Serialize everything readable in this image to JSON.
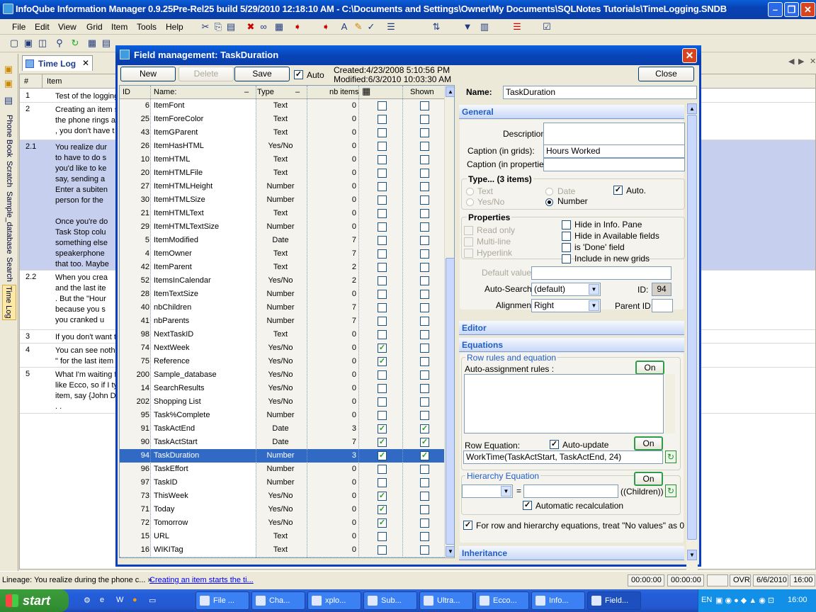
{
  "window": {
    "title": "InfoQube Information Manager 0.9.25Pre-Rel25  build 5/29/2010 12:18:10 AM - C:\\Documents and Settings\\Owner\\My Documents\\SQLNotes Tutorials\\TimeLogging.SNDB"
  },
  "menu": [
    "File",
    "Edit",
    "View",
    "Grid",
    "Item",
    "Tools",
    "Help"
  ],
  "left_tabs": [
    "Phone Book",
    "Scratch",
    "Sample_database",
    "Search",
    "Time Log"
  ],
  "doc_tab": {
    "label": "Time Log",
    "close": "✕"
  },
  "bg_grid": {
    "headers": {
      "num": "#",
      "item": "Item"
    },
    "rows": [
      {
        "num": "1",
        "lines": [
          "Test of the logging"
        ]
      },
      {
        "num": "2",
        "lines": [
          "Creating an item s",
          "the phone rings a",
          ", you don't have t"
        ]
      },
      {
        "num": "2.1",
        "lines": [
          "You realize dur",
          "to have to do s",
          "you'd like to ke",
          "say, sending a",
          "Enter a subiten",
          "person for the",
          "",
          "Once you're do",
          "Task Stop colu",
          "something else",
          "speakerphone",
          "that too. Maybe"
        ]
      },
      {
        "num": "2.2",
        "lines": [
          "When you crea",
          "and the last ite",
          ". But the \"Hour",
          "because you s",
          "you cranked u"
        ]
      },
      {
        "num": "3",
        "lines": [
          "If you don't want t"
        ]
      },
      {
        "num": "4",
        "lines": [
          "You can see noth",
          "\" for the last item"
        ]
      },
      {
        "num": "5",
        "lines": [
          "What I'm waiting f",
          "like Ecco, so if I ty",
          "item, say {John D",
          ". ."
        ]
      }
    ]
  },
  "dialog": {
    "title": "Field management: TaskDuration",
    "close": "✕",
    "buttons": {
      "new": "New",
      "delete": "Delete",
      "save": "Save",
      "close": "Close"
    },
    "auto_label": "Auto",
    "created": "Created:4/23/2008 5:10:56 PM",
    "modified": "Modified:6/3/2010 10:03:30 AM",
    "grid": {
      "headers": {
        "id": "ID",
        "name": "Name:",
        "type": "Type",
        "nb": "nb items",
        "shown": "Shown"
      },
      "rows": [
        {
          "id": "6",
          "name": "ItemFont",
          "type": "Text",
          "nb": "0",
          "a": false,
          "s": false
        },
        {
          "id": "25",
          "name": "ItemForeColor",
          "type": "Text",
          "nb": "0",
          "a": false,
          "s": false
        },
        {
          "id": "43",
          "name": "ItemGParent",
          "type": "Text",
          "nb": "0",
          "a": false,
          "s": false
        },
        {
          "id": "26",
          "name": "ItemHasHTML",
          "type": "Yes/No",
          "nb": "0",
          "a": false,
          "s": false
        },
        {
          "id": "10",
          "name": "ItemHTML",
          "type": "Text",
          "nb": "0",
          "a": false,
          "s": false
        },
        {
          "id": "20",
          "name": "ItemHTMLFile",
          "type": "Text",
          "nb": "0",
          "a": false,
          "s": false
        },
        {
          "id": "27",
          "name": "ItemHTMLHeight",
          "type": "Number",
          "nb": "0",
          "a": false,
          "s": false
        },
        {
          "id": "30",
          "name": "ItemHTMLSize",
          "type": "Number",
          "nb": "0",
          "a": false,
          "s": false
        },
        {
          "id": "21",
          "name": "ItemHTMLText",
          "type": "Text",
          "nb": "0",
          "a": false,
          "s": false
        },
        {
          "id": "29",
          "name": "ItemHTMLTextSize",
          "type": "Number",
          "nb": "0",
          "a": false,
          "s": false
        },
        {
          "id": "5",
          "name": "ItemModified",
          "type": "Date",
          "nb": "7",
          "a": false,
          "s": false
        },
        {
          "id": "4",
          "name": "ItemOwner",
          "type": "Text",
          "nb": "7",
          "a": false,
          "s": false
        },
        {
          "id": "42",
          "name": "ItemParent",
          "type": "Text",
          "nb": "2",
          "a": false,
          "s": false
        },
        {
          "id": "52",
          "name": "ItemsInCalendar",
          "type": "Yes/No",
          "nb": "2",
          "a": false,
          "s": false
        },
        {
          "id": "28",
          "name": "ItemTextSize",
          "type": "Number",
          "nb": "0",
          "a": false,
          "s": false
        },
        {
          "id": "40",
          "name": "nbChildren",
          "type": "Number",
          "nb": "7",
          "a": false,
          "s": false
        },
        {
          "id": "41",
          "name": "nbParents",
          "type": "Number",
          "nb": "7",
          "a": false,
          "s": false
        },
        {
          "id": "98",
          "name": "NextTaskID",
          "type": "Text",
          "nb": "0",
          "a": false,
          "s": false
        },
        {
          "id": "74",
          "name": "NextWeek",
          "type": "Yes/No",
          "nb": "0",
          "a": true,
          "s": false
        },
        {
          "id": "75",
          "name": "Reference",
          "type": "Yes/No",
          "nb": "0",
          "a": true,
          "s": false
        },
        {
          "id": "200",
          "name": "Sample_database",
          "type": "Yes/No",
          "nb": "0",
          "a": false,
          "s": false
        },
        {
          "id": "14",
          "name": "SearchResults",
          "type": "Yes/No",
          "nb": "0",
          "a": false,
          "s": false
        },
        {
          "id": "202",
          "name": "Shopping List",
          "type": "Yes/No",
          "nb": "0",
          "a": false,
          "s": false
        },
        {
          "id": "95",
          "name": "Task%Complete",
          "type": "Number",
          "nb": "0",
          "a": false,
          "s": false
        },
        {
          "id": "91",
          "name": "TaskActEnd",
          "type": "Date",
          "nb": "3",
          "a": true,
          "s": true
        },
        {
          "id": "90",
          "name": "TaskActStart",
          "type": "Date",
          "nb": "7",
          "a": true,
          "s": true
        },
        {
          "id": "94",
          "name": "TaskDuration",
          "type": "Number",
          "nb": "3",
          "a": true,
          "s": true,
          "selected": true
        },
        {
          "id": "96",
          "name": "TaskEffort",
          "type": "Number",
          "nb": "0",
          "a": false,
          "s": false
        },
        {
          "id": "97",
          "name": "TaskID",
          "type": "Number",
          "nb": "0",
          "a": false,
          "s": false
        },
        {
          "id": "73",
          "name": "ThisWeek",
          "type": "Yes/No",
          "nb": "0",
          "a": true,
          "s": false
        },
        {
          "id": "71",
          "name": "Today",
          "type": "Yes/No",
          "nb": "0",
          "a": true,
          "s": false
        },
        {
          "id": "72",
          "name": "Tomorrow",
          "type": "Yes/No",
          "nb": "0",
          "a": true,
          "s": false
        },
        {
          "id": "15",
          "name": "URL",
          "type": "Text",
          "nb": "0",
          "a": false,
          "s": false
        },
        {
          "id": "16",
          "name": "WIKITag",
          "type": "Text",
          "nb": "0",
          "a": false,
          "s": false
        }
      ]
    },
    "props": {
      "name_label": "Name:",
      "name_value": "TaskDuration",
      "general": "General",
      "description_label": "Description",
      "description_value": "",
      "caption_grids_label": "Caption (in grids):",
      "caption_grids_value": "Hours Worked",
      "caption_props_label": "Caption (in properties):",
      "caption_props_value": "",
      "type_label": "Type...  (3 items)",
      "type_text": "Text",
      "type_yesno": "Yes/No",
      "type_date": "Date",
      "type_number": "Number",
      "type_auto": "Auto.",
      "properties_label": "Properties",
      "readonly": "Read only",
      "multiline": "Multi-line",
      "hyperlink": "Hyperlink",
      "hide_info": "Hide in Info. Pane",
      "hide_avail": "Hide in Available fields",
      "is_done": "is 'Done' field",
      "include_new": "Include in new grids",
      "default_label": "Default value:",
      "default_value": "",
      "autosearch_label": "Auto-Search:",
      "autosearch_value": "(default)",
      "id_label": "ID:",
      "id_value": "94",
      "alignment_label": "Alignment",
      "alignment_value": "Right",
      "parentid_label": "Parent ID:",
      "parentid_value": "",
      "editor": "Editor",
      "equations": "Equations",
      "row_rules_label": "Row rules and equation",
      "auto_assign_label": "Auto-assignment rules :",
      "on": "On",
      "row_eq_label": "Row Equation:",
      "auto_update": "Auto-update",
      "row_eq_value": "WorkTime(TaskActStart, TaskActEnd, 24)",
      "hier_label": "Hierarchy Equation",
      "hier_equals": "=",
      "hier_children": "((Children))",
      "auto_recalc": "Automatic recalculation",
      "no_values": "For row and hierarchy equations, treat \"No values\" as 0",
      "inheritance": "Inheritance"
    }
  },
  "status": {
    "lineage_prefix": "Lineage: You realize during the phone c... »",
    "lineage_link": "Creating an item starts the ti...",
    "time1": "00:00:00",
    "time2": "00:00:00",
    "ovr": "OVR",
    "date": "6/6/2010",
    "time": "16:00"
  },
  "taskbar": {
    "start": "start",
    "buttons": [
      "File ...",
      "Cha...",
      "xplo...",
      "Sub...",
      "Ultra...",
      "Ecco...",
      "Info...",
      "Field..."
    ],
    "lang": "EN",
    "clock": "16:00"
  }
}
